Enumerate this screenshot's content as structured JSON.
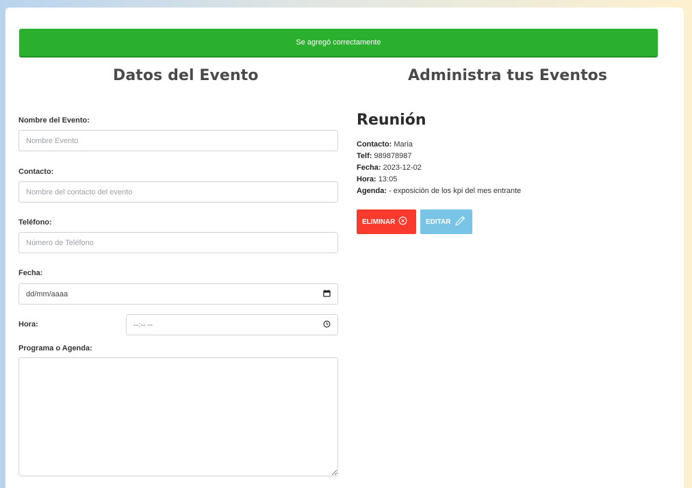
{
  "alert": {
    "message": "Se agregó correctamente"
  },
  "form": {
    "title": "Datos del Evento",
    "name_label": "Nombre del Evento:",
    "name_placeholder": "Nombre Evento",
    "contact_label": "Contacto:",
    "contact_placeholder": "Nombre del contacto del evento",
    "phone_label": "Teléfono:",
    "phone_placeholder": "Número de Teléfono",
    "date_label": "Fecha:",
    "date_value": "dd/mm/aaaa",
    "time_label": "Hora:",
    "time_value": "--:-- --",
    "agenda_label": "Programa o Agenda:"
  },
  "events": {
    "title": "Administra tus Eventos",
    "event": {
      "name": "Reunión",
      "contact_label": "Contacto:",
      "contact_value": "Maria",
      "phone_label": "Telf:",
      "phone_value": "989878987",
      "date_label": "Fecha:",
      "date_value": "2023-12-02",
      "time_label": "Hora:",
      "time_value": "13:05",
      "agenda_label": "Agenda:",
      "agenda_value": "- exposición de los kpi del mes entrante",
      "delete_label": "ELIMINAR",
      "edit_label": "EDITAR"
    }
  },
  "colors": {
    "success": "#2aaf2e",
    "danger": "#fb3a2e",
    "info": "#79c4e6"
  },
  "icons": [
    "calendar-icon",
    "clock-icon",
    "close-circle-icon",
    "pencil-icon"
  ]
}
